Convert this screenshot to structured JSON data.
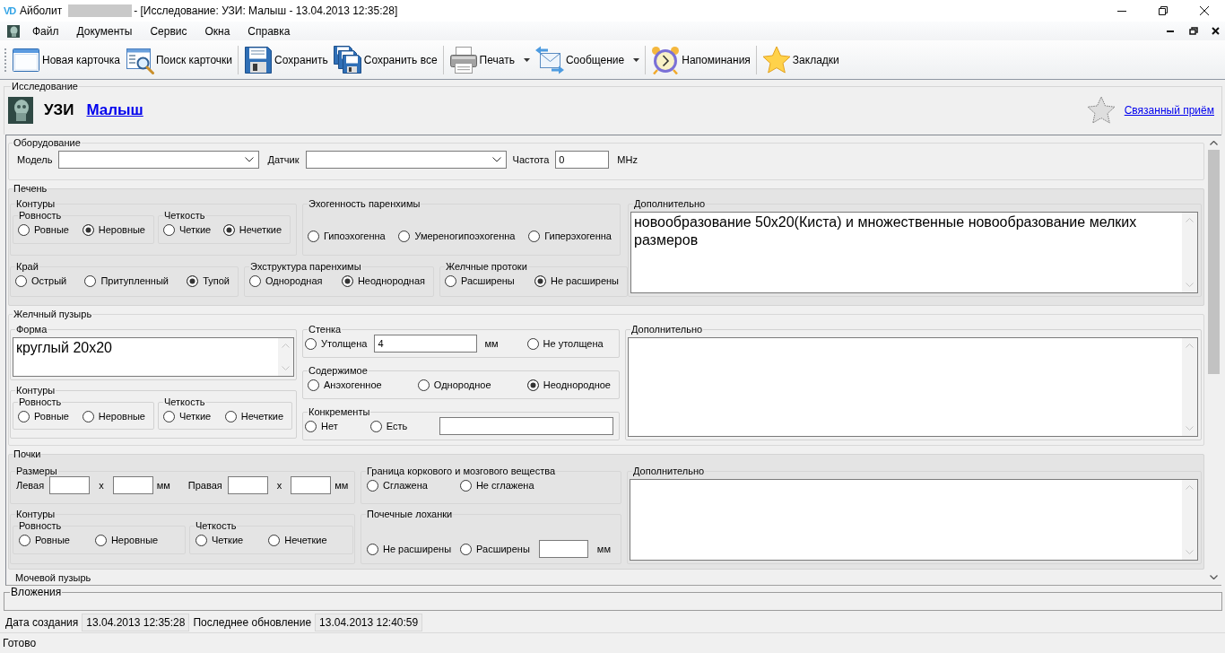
{
  "window": {
    "logo": "VD",
    "app": "Айболит",
    "title": "- [Исследование: УЗИ: Малыш - 13.04.2013 12:35:28]"
  },
  "menu": [
    "Файл",
    "Документы",
    "Сервис",
    "Окна",
    "Справка"
  ],
  "toolbar": [
    {
      "items": [
        {
          "kind": "new",
          "label": "Новая карточка",
          "dropdown": false
        },
        {
          "kind": "find",
          "label": "Поиск карточки",
          "dropdown": false
        }
      ]
    },
    {
      "items": [
        {
          "kind": "save",
          "label": "Сохранить",
          "dropdown": false
        },
        {
          "kind": "save-all",
          "label": "Сохранить все",
          "dropdown": false
        }
      ]
    },
    {
      "items": [
        {
          "kind": "print",
          "label": "Печать",
          "dropdown": true
        },
        {
          "kind": "message",
          "label": "Сообщение",
          "dropdown": true
        }
      ]
    },
    {
      "items": [
        {
          "kind": "reminders",
          "label": "Напоминания",
          "dropdown": false
        }
      ]
    },
    {
      "items": [
        {
          "kind": "bookmarks",
          "label": "Закладки",
          "dropdown": false
        }
      ]
    }
  ],
  "document": {
    "group": "Исследование",
    "study": "УЗИ",
    "patient": "Малыш",
    "related_link": "Связанный приём"
  },
  "equipment": {
    "title": "Оборудование",
    "model": {
      "label": "Модель"
    },
    "sensor": {
      "label": "Датчик"
    },
    "frequency": {
      "label": "Частота",
      "value": "0",
      "unit": "MHz"
    }
  },
  "liver": {
    "title": "Печень",
    "contours": {
      "title": "Контуры",
      "groups": [
        {
          "title": "Ровность",
          "options": [
            {
              "label": "Ровные",
              "selected": false
            },
            {
              "label": "Неровные",
              "selected": true
            }
          ]
        },
        {
          "title": "Четкость",
          "options": [
            {
              "label": "Четкие",
              "selected": false
            },
            {
              "label": "Нечеткие",
              "selected": true
            }
          ]
        }
      ]
    },
    "echogenicity": {
      "title": "Эхогенность паренхимы",
      "options": [
        {
          "label": "Гипоэхогенна",
          "selected": false
        },
        {
          "label": "Умереногипоэхогенна",
          "selected": false
        },
        {
          "label": "Гиперэхогенна",
          "selected": false
        }
      ]
    },
    "edge": {
      "title": "Край",
      "options": [
        {
          "label": "Острый",
          "selected": false
        },
        {
          "label": "Притупленный",
          "selected": false
        },
        {
          "label": "Тупой",
          "selected": true
        }
      ]
    },
    "echostructure": {
      "title": "Эхструктура паренхимы",
      "options": [
        {
          "label": "Однородная",
          "selected": false
        },
        {
          "label": "Неоднородная",
          "selected": true
        }
      ]
    },
    "bile_ducts": {
      "title": "Желчные протоки",
      "options": [
        {
          "label": "Расширены",
          "selected": false
        },
        {
          "label": "Не расширены",
          "selected": true
        }
      ]
    },
    "notes": {
      "title": "Дополнительно",
      "value": "новообразование 50x20(Киста) и множественные новообразование мелких размеров"
    }
  },
  "gallbladder": {
    "title": "Желчный пузырь",
    "shape": {
      "title": "Форма",
      "value": "круглый 20x20"
    },
    "contours": {
      "title": "Контуры",
      "groups": [
        {
          "title": "Ровность",
          "options": [
            {
              "label": "Ровные",
              "selected": false
            },
            {
              "label": "Неровные",
              "selected": false
            }
          ]
        },
        {
          "title": "Четкость",
          "options": [
            {
              "label": "Четкие",
              "selected": false
            },
            {
              "label": "Нечеткие",
              "selected": false
            }
          ]
        }
      ]
    },
    "wall": {
      "title": "Стенка",
      "options": [
        {
          "label": "Утолщена",
          "selected": false
        },
        {
          "label": "Не утолщена",
          "selected": false
        }
      ],
      "value": "4",
      "unit": "мм"
    },
    "contents": {
      "title": "Содержимое",
      "options": [
        {
          "label": "Анэхогенное",
          "selected": false
        },
        {
          "label": "Однородное",
          "selected": false
        },
        {
          "label": "Неоднородное",
          "selected": true
        }
      ]
    },
    "stones": {
      "title": "Конкременты",
      "options": [
        {
          "label": "Нет",
          "selected": false
        },
        {
          "label": "Есть",
          "selected": false
        }
      ]
    },
    "notes": {
      "title": "Дополнительно"
    }
  },
  "kidneys": {
    "title": "Почки",
    "sizes": {
      "title": "Размеры",
      "sides": [
        {
          "label": "Левая",
          "by": "x",
          "unit": "мм"
        },
        {
          "label": "Правая",
          "by": "x",
          "unit": "мм"
        }
      ]
    },
    "border": {
      "title": "Граница коркового и мозгового вещества",
      "options": [
        {
          "label": "Сглажена",
          "selected": false
        },
        {
          "label": "Не сглажена",
          "selected": false
        }
      ]
    },
    "contours": {
      "title": "Контуры",
      "groups": [
        {
          "title": "Ровность",
          "options": [
            {
              "label": "Ровные",
              "selected": false
            },
            {
              "label": "Неровные",
              "selected": false
            }
          ]
        },
        {
          "title": "Четкость",
          "options": [
            {
              "label": "Четкие",
              "selected": false
            },
            {
              "label": "Нечеткие",
              "selected": false
            }
          ]
        }
      ]
    },
    "pelvis": {
      "title": "Почечные лоханки",
      "options": [
        {
          "label": "Не расширены",
          "selected": false
        },
        {
          "label": "Расширены",
          "selected": false
        }
      ],
      "unit": "мм"
    },
    "notes": {
      "title": "Дополнительно"
    }
  },
  "next_section": {
    "title": "Мочевой пузырь"
  },
  "attachments": {
    "title": "Вложения"
  },
  "dates": [
    {
      "label": "Дата создания",
      "value": "13.04.2013 12:35:28"
    },
    {
      "label": "Последнее обновление",
      "value": "13.04.2013 12:40:59"
    }
  ],
  "status_bar": {
    "text": "Готово"
  }
}
